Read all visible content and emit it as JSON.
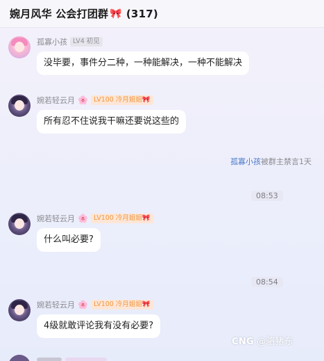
{
  "header": {
    "group_name": "婉月风华 公会打团群",
    "ribbon": "🎀",
    "member_count": "(317)"
  },
  "messages": [
    {
      "sender": "孤寡小孩",
      "level": "LV4 初见",
      "text": "没毕要，事件分二种，一种能解决，一种不能解决"
    },
    {
      "sender": "婉若轻云月",
      "flower": "🌸",
      "level": "LV100 冷月姐姐",
      "level_ribbon": "🎀",
      "text": "所有忍不住说我干嘛还要说这些的"
    },
    {
      "sender": "婉若轻云月",
      "flower": "🌸",
      "level": "LV100 冷月姐姐",
      "level_ribbon": "🎀",
      "text": "什么叫必要?"
    },
    {
      "sender": "婉若轻云月",
      "flower": "🌸",
      "level": "LV100 冷月姐姐",
      "level_ribbon": "🎀",
      "text": "4级就敢评论我有没有必要?"
    }
  ],
  "notice": {
    "user": "孤寡小孩",
    "text": "被群主禁言1天"
  },
  "times": [
    "08:53",
    "08:54"
  ],
  "watermark": {
    "logo": "CNG",
    "handle": "@骆猪东"
  },
  "colors": {
    "accent_link": "#4a78c8",
    "badge_orange": "#f0963f",
    "ribbon_pink": "#ff5fa2"
  }
}
